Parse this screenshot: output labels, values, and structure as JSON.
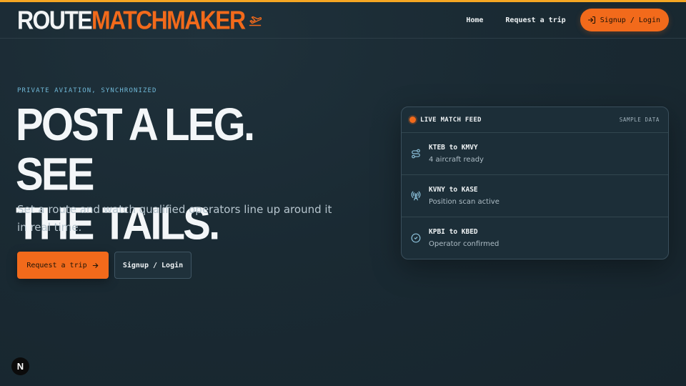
{
  "header": {
    "logo_part1": "ROUTE",
    "logo_part2": "MATCHMAKER",
    "logo_icon": "plane-takeoff-icon",
    "nav": {
      "home": "Home",
      "request_trip": "Request a trip",
      "signup_login": "Signup / Login"
    }
  },
  "hero": {
    "eyebrow": "PRIVATE AVIATION, SYNCHRONIZED",
    "headline_line1": "POST A LEG. SEE",
    "headline_line2": "THE TAILS.",
    "subtitle": "Set a route and watch qualified operators line up around it in real time.",
    "cta_primary": "Request a trip",
    "cta_secondary": "Signup / Login"
  },
  "feed": {
    "title": "LIVE MATCH FEED",
    "badge": "SAMPLE DATA",
    "items": [
      {
        "route": "KTEB to KMVY",
        "status": "4 aircraft ready",
        "icon": "route-icon"
      },
      {
        "route": "KVNY to KASE",
        "status": "Position scan active",
        "icon": "radio-tower-icon"
      },
      {
        "route": "KPBI to KBED",
        "status": "Operator confirmed",
        "icon": "check-circle-icon"
      }
    ]
  },
  "dev_badge": "N",
  "colors": {
    "accent": "#f26a1b",
    "top_bar": "#f5a623",
    "background": "#1a2a33",
    "eyebrow": "#6fb7d6"
  }
}
